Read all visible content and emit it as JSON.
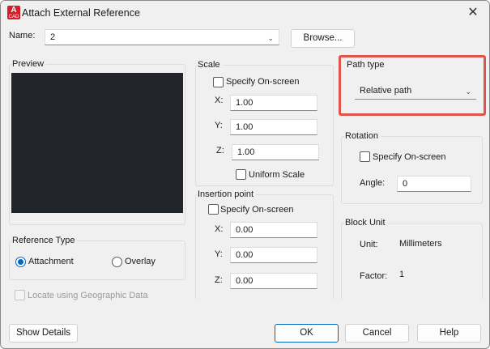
{
  "window": {
    "title": "Attach External Reference",
    "app_icon_letter": "A",
    "app_icon_sub": "CAD",
    "close_glyph": "✕"
  },
  "name": {
    "label": "Name:",
    "value": "2",
    "browse_label": "Browse..."
  },
  "preview": {
    "title": "Preview"
  },
  "scale": {
    "title": "Scale",
    "specify_label": "Specify On-screen",
    "x_label": "X:",
    "x_value": "1.00",
    "y_label": "Y:",
    "y_value": "1.00",
    "z_label": "Z:",
    "z_value": "1.00",
    "uniform_label": "Uniform Scale"
  },
  "insertion": {
    "title": "Insertion point",
    "specify_label": "Specify On-screen",
    "x_label": "X:",
    "x_value": "0.00",
    "y_label": "Y:",
    "y_value": "0.00",
    "z_label": "Z:",
    "z_value": "0.00"
  },
  "path_type": {
    "title": "Path type",
    "selected": "Relative path"
  },
  "rotation": {
    "title": "Rotation",
    "specify_label": "Specify On-screen",
    "angle_label": "Angle:",
    "angle_value": "0"
  },
  "block_unit": {
    "title": "Block Unit",
    "unit_label": "Unit:",
    "unit_value": "Millimeters",
    "factor_label": "Factor:",
    "factor_value": "1"
  },
  "reference_type": {
    "title": "Reference Type",
    "attachment_label": "Attachment",
    "overlay_label": "Overlay",
    "selected": "Attachment"
  },
  "geo": {
    "label": "Locate using Geographic Data"
  },
  "footer": {
    "details_label": "Show Details",
    "ok_label": "OK",
    "cancel_label": "Cancel",
    "help_label": "Help"
  },
  "colors": {
    "highlight": "#e0534a",
    "accent": "#0067c0",
    "preview_bg": "#22262b",
    "app_icon": "#d21f2a"
  },
  "icons": [
    "app-icon",
    "close-icon",
    "chevron-down-icon"
  ]
}
